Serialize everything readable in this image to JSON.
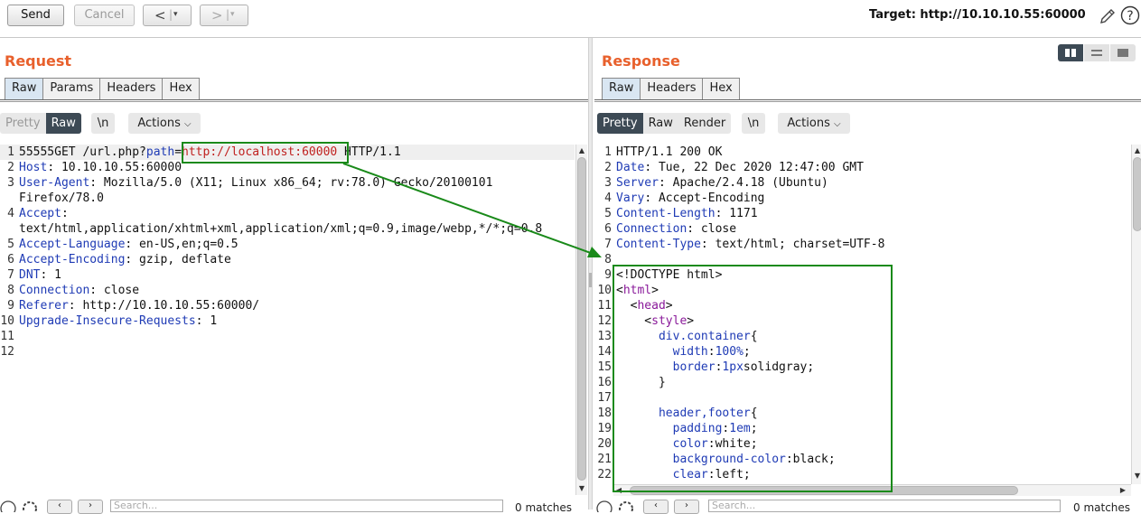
{
  "toolbar": {
    "send_label": "Send",
    "cancel_label": "Cancel",
    "back_glyph": "<",
    "forward_glyph": ">",
    "dropdown_glyph": "▾",
    "target_label": "Target: http://10.10.10.55:60000"
  },
  "request": {
    "title": "Request",
    "tabs": [
      "Raw",
      "Params",
      "Headers",
      "Hex"
    ],
    "active_tab": "Raw",
    "modes": [
      "Pretty",
      "Raw"
    ],
    "newline_label": "\\n",
    "actions_label": "Actions",
    "lines": [
      {
        "n": "1",
        "parts": [
          [
            "55555GET /url.php?",
            ""
          ],
          [
            "path",
            "k"
          ],
          [
            "=",
            ""
          ],
          [
            "http://localhost:60000",
            "red"
          ],
          [
            " HTTP/1.1",
            ""
          ]
        ]
      },
      {
        "n": "2",
        "parts": [
          [
            "Host",
            "k"
          ],
          [
            ": 10.10.10.55:60000",
            ""
          ]
        ]
      },
      {
        "n": "3",
        "parts": [
          [
            "User-Agent",
            "k"
          ],
          [
            ": Mozilla/5.0 (X11; Linux x86_64; rv:78.0) Gecko/20100101",
            ""
          ]
        ]
      },
      {
        "n": "",
        "parts": [
          [
            "Firefox/78.0",
            ""
          ]
        ]
      },
      {
        "n": "4",
        "parts": [
          [
            "Accept",
            "k"
          ],
          [
            ":",
            ""
          ]
        ]
      },
      {
        "n": "",
        "parts": [
          [
            "text/html,application/xhtml+xml,application/xml;q=0.9,image/webp,*/*;q=0.8",
            ""
          ]
        ]
      },
      {
        "n": "5",
        "parts": [
          [
            "Accept-Language",
            "k"
          ],
          [
            ": en-US,en;q=0.5",
            ""
          ]
        ]
      },
      {
        "n": "6",
        "parts": [
          [
            "Accept-Encoding",
            "k"
          ],
          [
            ": gzip, deflate",
            ""
          ]
        ]
      },
      {
        "n": "7",
        "parts": [
          [
            "DNT",
            "k"
          ],
          [
            ": 1",
            ""
          ]
        ]
      },
      {
        "n": "8",
        "parts": [
          [
            "Connection",
            "k"
          ],
          [
            ": close",
            ""
          ]
        ]
      },
      {
        "n": "9",
        "parts": [
          [
            "Referer",
            "k"
          ],
          [
            ": http://10.10.10.55:60000/",
            ""
          ]
        ]
      },
      {
        "n": "10",
        "parts": [
          [
            "Upgrade-Insecure-Requests",
            "k"
          ],
          [
            ": 1",
            ""
          ]
        ]
      },
      {
        "n": "11",
        "parts": []
      },
      {
        "n": "12",
        "parts": []
      }
    ],
    "search_placeholder": "Search...",
    "matches": "0 matches"
  },
  "response": {
    "title": "Response",
    "tabs": [
      "Raw",
      "Headers",
      "Hex"
    ],
    "active_tab": "Raw",
    "modes": [
      "Pretty",
      "Raw",
      "Render"
    ],
    "newline_label": "\\n",
    "actions_label": "Actions",
    "lines": [
      {
        "n": "1",
        "parts": [
          [
            "HTTP/1.1 200 OK",
            ""
          ]
        ]
      },
      {
        "n": "2",
        "parts": [
          [
            "Date",
            "k"
          ],
          [
            ": Tue, 22 Dec 2020 12:47:00 GMT",
            ""
          ]
        ]
      },
      {
        "n": "3",
        "parts": [
          [
            "Server",
            "k"
          ],
          [
            ": Apache/2.4.18 (Ubuntu)",
            ""
          ]
        ]
      },
      {
        "n": "4",
        "parts": [
          [
            "Vary",
            "k"
          ],
          [
            ": Accept-Encoding",
            ""
          ]
        ]
      },
      {
        "n": "5",
        "parts": [
          [
            "Content-Length",
            "k"
          ],
          [
            ": 1171",
            ""
          ]
        ]
      },
      {
        "n": "6",
        "parts": [
          [
            "Connection",
            "k"
          ],
          [
            ": close",
            ""
          ]
        ]
      },
      {
        "n": "7",
        "parts": [
          [
            "Content-Type",
            "k"
          ],
          [
            ": text/html; charset=UTF-8",
            ""
          ]
        ]
      },
      {
        "n": "8",
        "parts": []
      },
      {
        "n": "9",
        "parts": [
          [
            "<!DOCTYPE html>",
            ""
          ]
        ]
      },
      {
        "n": "10",
        "parts": [
          [
            "<",
            ""
          ],
          [
            "html",
            "tag"
          ],
          [
            ">",
            ""
          ]
        ]
      },
      {
        "n": "11",
        "parts": [
          [
            "  <",
            ""
          ],
          [
            "head",
            "tag"
          ],
          [
            ">",
            ""
          ]
        ]
      },
      {
        "n": "12",
        "parts": [
          [
            "    <",
            ""
          ],
          [
            "style",
            "tag"
          ],
          [
            ">",
            ""
          ]
        ]
      },
      {
        "n": "13",
        "parts": [
          [
            "      ",
            ""
          ],
          [
            "div.container",
            "k"
          ],
          [
            "{",
            ""
          ]
        ]
      },
      {
        "n": "14",
        "parts": [
          [
            "        ",
            ""
          ],
          [
            "width",
            "k"
          ],
          [
            ":",
            ""
          ],
          [
            "100%",
            "num"
          ],
          [
            ";",
            ""
          ]
        ]
      },
      {
        "n": "15",
        "parts": [
          [
            "        ",
            ""
          ],
          [
            "border",
            "k"
          ],
          [
            ":",
            ""
          ],
          [
            "1px",
            "num"
          ],
          [
            "solidgray;",
            ""
          ]
        ]
      },
      {
        "n": "16",
        "parts": [
          [
            "      }",
            ""
          ]
        ]
      },
      {
        "n": "17",
        "parts": []
      },
      {
        "n": "18",
        "parts": [
          [
            "      ",
            ""
          ],
          [
            "header,footer",
            "k"
          ],
          [
            "{",
            ""
          ]
        ]
      },
      {
        "n": "19",
        "parts": [
          [
            "        ",
            ""
          ],
          [
            "padding",
            "k"
          ],
          [
            ":",
            ""
          ],
          [
            "1em",
            "num"
          ],
          [
            ";",
            ""
          ]
        ]
      },
      {
        "n": "20",
        "parts": [
          [
            "        ",
            ""
          ],
          [
            "color",
            "k"
          ],
          [
            ":white;",
            ""
          ]
        ]
      },
      {
        "n": "21",
        "parts": [
          [
            "        ",
            ""
          ],
          [
            "background-color",
            "k"
          ],
          [
            ":black;",
            ""
          ]
        ]
      },
      {
        "n": "22",
        "parts": [
          [
            "        ",
            ""
          ],
          [
            "clear",
            "k"
          ],
          [
            ":left;",
            ""
          ]
        ]
      }
    ],
    "search_placeholder": "Search...",
    "matches": "0 matches"
  },
  "colors": {
    "accent_title": "#e8602c",
    "annotation_green": "#1a8a1a",
    "header_key": "#1f3bb5",
    "url_value": "#c0211f",
    "tag": "#8a1a9a"
  }
}
